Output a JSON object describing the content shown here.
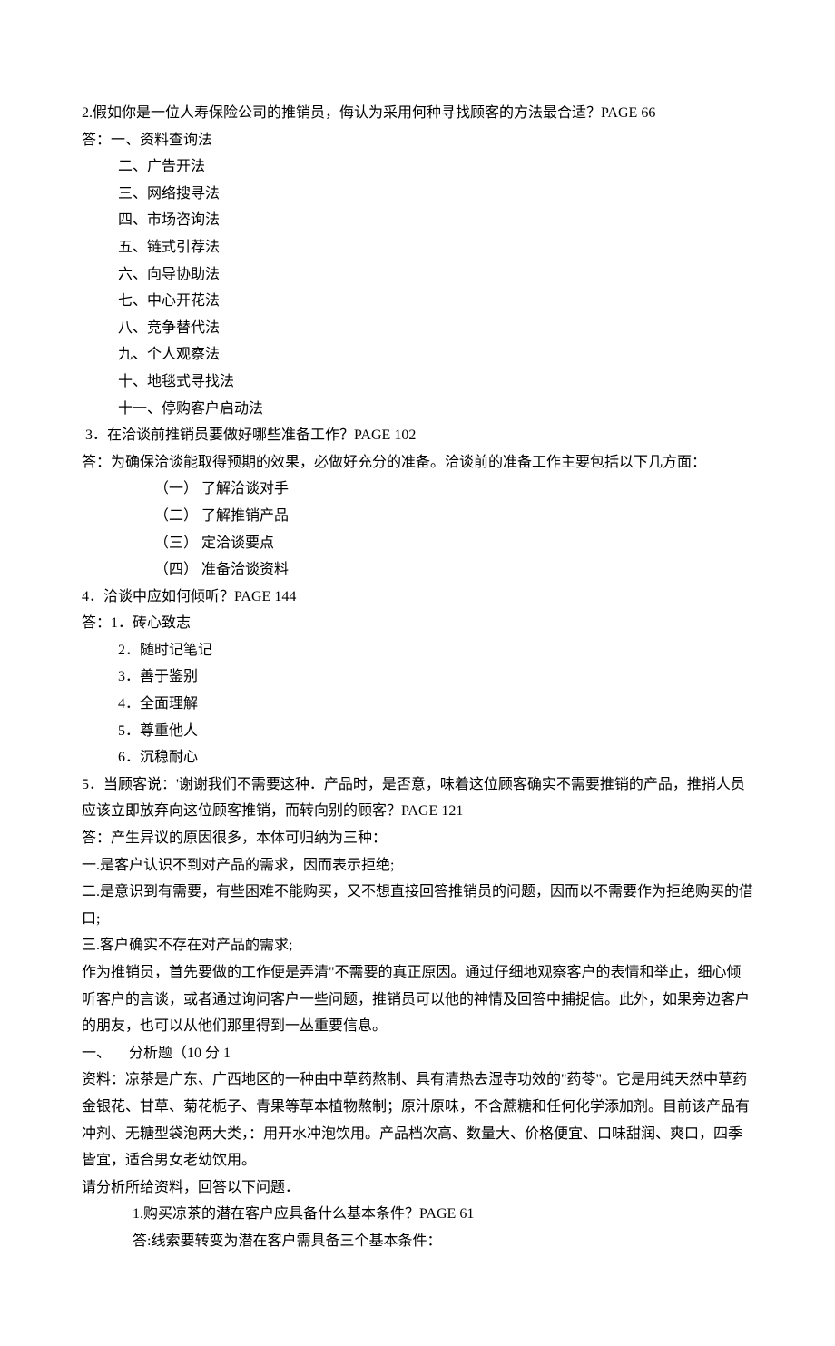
{
  "q2": {
    "prompt": "2.假如你是一位人寿保险公司的推销员，侮认为采用何种寻找顾客的方法最合适？PAGE 66",
    "ansLead": "答：一、资料查询法",
    "items": [
      "二、广告开法",
      "三、网络搜寻法",
      "四、市场咨询法",
      "五、链式引荐法",
      "六、向导协助法",
      "七、中心开花法",
      "八、竞争替代法",
      "九、个人观察法",
      "十、地毯式寻找法",
      "十一、停购客户启动法"
    ]
  },
  "q3": {
    "prompt": " 3．在洽谈前推销员要做好哪些准备工作？PAGE 102",
    "ansLead": "答：为确保洽谈能取得预期的效果，必做好充分的准备。洽谈前的准备工作主要包括以下几方面：",
    "items": [
      "（一） 了解洽谈对手",
      "（二） 了解推销产品",
      "（三） 定洽谈要点",
      "（四） 准备洽谈资料"
    ]
  },
  "q4": {
    "prompt": "4．洽谈中应如何倾听？PAGE 144",
    "ansLead": "答：1．砖心致志",
    "items": [
      "2．随时记笔记",
      "3．善于鉴别",
      "4．全面理解",
      "5．尊重他人",
      "6．沉稳耐心"
    ]
  },
  "q5": {
    "prompt": "5．当顾客说：'谢谢我们不需要这种．产品时，是否意，味着这位顾客确实不需要推销的产品，推捎人员应该立即放弃向这位顾客推销，而转向别的顾客？PAGE 121",
    "ansLead": "答：产生异议的原因很多，本体可归纳为三种：",
    "items": [
      "一.是客户认识不到对产品的需求，因而表示拒绝;",
      "二.是意识到有需要，有些困难不能购买，又不想直接回答推销员的问题，因而以不需要作为拒绝购买的借口;",
      "三.客户确实不存在对产品酌需求;"
    ],
    "tail": "作为推销员，首先要做的工作便是弄清\"不需要的真正原因。通过仔细地观察客户的表情和举止，细心倾听客户的言谈，或者通过询问客户一些问题，推销员可以他的神情及回答中捕捉信。此外，如果旁边客户的朋友，也可以从他们那里得到一丛重要信息。"
  },
  "analysis": {
    "header": "一、     分析题（10 分 1",
    "material": "资料：凉茶是广东、广西地区的一种由中草药熬制、具有清热去湿寺功效的\"药苓\"。它是用纯天然中草药金银花、甘草、菊花栀子、青果等草本植物熬制；原汁原味，不含蔗糖和任何化学添加剂。目前该产品有冲剂、无糖型袋泡两大类，：用开水冲泡饮用。产品档次高、数量大、价格便宜、口味甜润、爽口，四季皆宜，适合男女老幼饮用。",
    "instruction": "请分析所给资料，回答以下问题．",
    "sub1": "1.购买凉茶的潜在客户应具备什么基本条件？PAGE 61",
    "sub1ans": "答:线索要转变为潜在客户需具备三个基本条件："
  }
}
